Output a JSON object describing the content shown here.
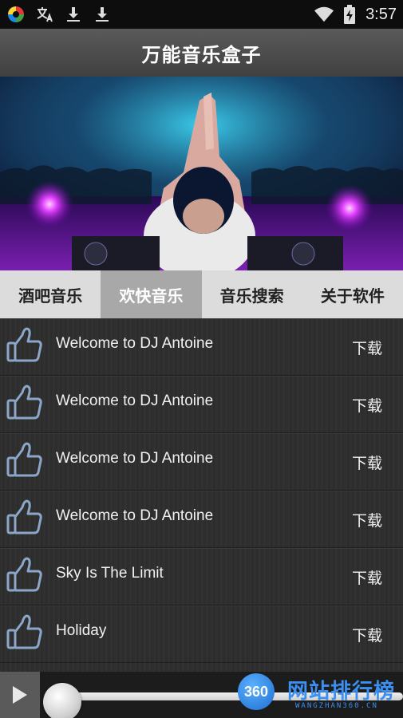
{
  "status_bar": {
    "time": "3:57",
    "left_icons": [
      "app-logo-icon",
      "translate-icon",
      "download-icon",
      "download-icon"
    ],
    "right_icons": [
      "wifi-icon",
      "battery-charging-icon"
    ]
  },
  "header": {
    "title": "万能音乐盒子"
  },
  "banner": {
    "image": "dj-concert-photo"
  },
  "tabs": [
    {
      "label": "酒吧音乐",
      "active": false
    },
    {
      "label": "欢快音乐",
      "active": true
    },
    {
      "label": "音乐搜索",
      "active": false
    },
    {
      "label": "关于软件",
      "active": false
    }
  ],
  "songs": [
    {
      "title": "Welcome to DJ Antoine",
      "action": "下载"
    },
    {
      "title": "Welcome to DJ Antoine",
      "action": "下载"
    },
    {
      "title": "Welcome to DJ Antoine",
      "action": "下载"
    },
    {
      "title": "Welcome to DJ Antoine",
      "action": "下载"
    },
    {
      "title": "Sky Is The Limit",
      "action": "下载"
    },
    {
      "title": "Holiday",
      "action": "下载"
    }
  ],
  "player": {
    "progress": 0.0
  },
  "watermark": {
    "badge": "360",
    "text": "网站排行榜",
    "sub": "WANGZHAN360.CN"
  },
  "colors": {
    "tab_active_bg": "#a8a8a8",
    "watermark": "#3a8ff0",
    "status_bar": "#0d0d0d"
  }
}
